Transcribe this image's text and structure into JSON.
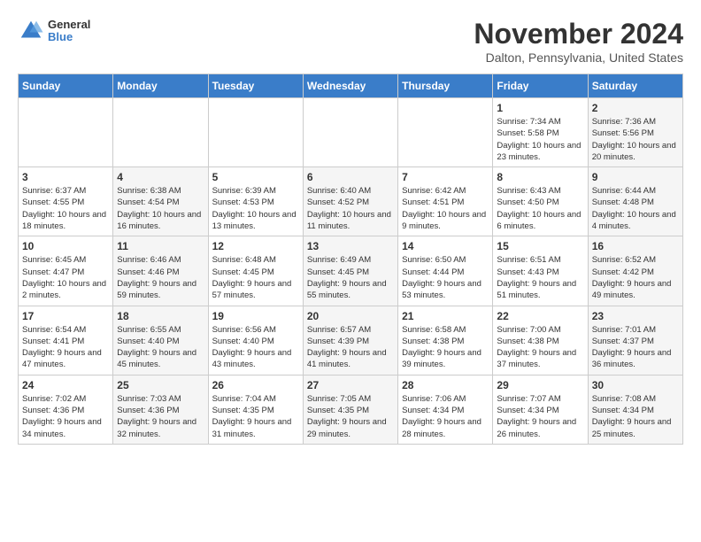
{
  "header": {
    "logo_general": "General",
    "logo_blue": "Blue",
    "month_title": "November 2024",
    "location": "Dalton, Pennsylvania, United States"
  },
  "weekdays": [
    "Sunday",
    "Monday",
    "Tuesday",
    "Wednesday",
    "Thursday",
    "Friday",
    "Saturday"
  ],
  "weeks": [
    [
      {
        "day": "",
        "sunrise": "",
        "sunset": "",
        "daylight": "",
        "shaded": false
      },
      {
        "day": "",
        "sunrise": "",
        "sunset": "",
        "daylight": "",
        "shaded": false
      },
      {
        "day": "",
        "sunrise": "",
        "sunset": "",
        "daylight": "",
        "shaded": false
      },
      {
        "day": "",
        "sunrise": "",
        "sunset": "",
        "daylight": "",
        "shaded": false
      },
      {
        "day": "",
        "sunrise": "",
        "sunset": "",
        "daylight": "",
        "shaded": false
      },
      {
        "day": "1",
        "sunrise": "Sunrise: 7:34 AM",
        "sunset": "Sunset: 5:58 PM",
        "daylight": "Daylight: 10 hours and 23 minutes.",
        "shaded": false
      },
      {
        "day": "2",
        "sunrise": "Sunrise: 7:36 AM",
        "sunset": "Sunset: 5:56 PM",
        "daylight": "Daylight: 10 hours and 20 minutes.",
        "shaded": true
      }
    ],
    [
      {
        "day": "3",
        "sunrise": "Sunrise: 6:37 AM",
        "sunset": "Sunset: 4:55 PM",
        "daylight": "Daylight: 10 hours and 18 minutes.",
        "shaded": false
      },
      {
        "day": "4",
        "sunrise": "Sunrise: 6:38 AM",
        "sunset": "Sunset: 4:54 PM",
        "daylight": "Daylight: 10 hours and 16 minutes.",
        "shaded": true
      },
      {
        "day": "5",
        "sunrise": "Sunrise: 6:39 AM",
        "sunset": "Sunset: 4:53 PM",
        "daylight": "Daylight: 10 hours and 13 minutes.",
        "shaded": false
      },
      {
        "day": "6",
        "sunrise": "Sunrise: 6:40 AM",
        "sunset": "Sunset: 4:52 PM",
        "daylight": "Daylight: 10 hours and 11 minutes.",
        "shaded": true
      },
      {
        "day": "7",
        "sunrise": "Sunrise: 6:42 AM",
        "sunset": "Sunset: 4:51 PM",
        "daylight": "Daylight: 10 hours and 9 minutes.",
        "shaded": false
      },
      {
        "day": "8",
        "sunrise": "Sunrise: 6:43 AM",
        "sunset": "Sunset: 4:50 PM",
        "daylight": "Daylight: 10 hours and 6 minutes.",
        "shaded": false
      },
      {
        "day": "9",
        "sunrise": "Sunrise: 6:44 AM",
        "sunset": "Sunset: 4:48 PM",
        "daylight": "Daylight: 10 hours and 4 minutes.",
        "shaded": true
      }
    ],
    [
      {
        "day": "10",
        "sunrise": "Sunrise: 6:45 AM",
        "sunset": "Sunset: 4:47 PM",
        "daylight": "Daylight: 10 hours and 2 minutes.",
        "shaded": false
      },
      {
        "day": "11",
        "sunrise": "Sunrise: 6:46 AM",
        "sunset": "Sunset: 4:46 PM",
        "daylight": "Daylight: 9 hours and 59 minutes.",
        "shaded": true
      },
      {
        "day": "12",
        "sunrise": "Sunrise: 6:48 AM",
        "sunset": "Sunset: 4:45 PM",
        "daylight": "Daylight: 9 hours and 57 minutes.",
        "shaded": false
      },
      {
        "day": "13",
        "sunrise": "Sunrise: 6:49 AM",
        "sunset": "Sunset: 4:45 PM",
        "daylight": "Daylight: 9 hours and 55 minutes.",
        "shaded": true
      },
      {
        "day": "14",
        "sunrise": "Sunrise: 6:50 AM",
        "sunset": "Sunset: 4:44 PM",
        "daylight": "Daylight: 9 hours and 53 minutes.",
        "shaded": false
      },
      {
        "day": "15",
        "sunrise": "Sunrise: 6:51 AM",
        "sunset": "Sunset: 4:43 PM",
        "daylight": "Daylight: 9 hours and 51 minutes.",
        "shaded": false
      },
      {
        "day": "16",
        "sunrise": "Sunrise: 6:52 AM",
        "sunset": "Sunset: 4:42 PM",
        "daylight": "Daylight: 9 hours and 49 minutes.",
        "shaded": true
      }
    ],
    [
      {
        "day": "17",
        "sunrise": "Sunrise: 6:54 AM",
        "sunset": "Sunset: 4:41 PM",
        "daylight": "Daylight: 9 hours and 47 minutes.",
        "shaded": false
      },
      {
        "day": "18",
        "sunrise": "Sunrise: 6:55 AM",
        "sunset": "Sunset: 4:40 PM",
        "daylight": "Daylight: 9 hours and 45 minutes.",
        "shaded": true
      },
      {
        "day": "19",
        "sunrise": "Sunrise: 6:56 AM",
        "sunset": "Sunset: 4:40 PM",
        "daylight": "Daylight: 9 hours and 43 minutes.",
        "shaded": false
      },
      {
        "day": "20",
        "sunrise": "Sunrise: 6:57 AM",
        "sunset": "Sunset: 4:39 PM",
        "daylight": "Daylight: 9 hours and 41 minutes.",
        "shaded": true
      },
      {
        "day": "21",
        "sunrise": "Sunrise: 6:58 AM",
        "sunset": "Sunset: 4:38 PM",
        "daylight": "Daylight: 9 hours and 39 minutes.",
        "shaded": false
      },
      {
        "day": "22",
        "sunrise": "Sunrise: 7:00 AM",
        "sunset": "Sunset: 4:38 PM",
        "daylight": "Daylight: 9 hours and 37 minutes.",
        "shaded": false
      },
      {
        "day": "23",
        "sunrise": "Sunrise: 7:01 AM",
        "sunset": "Sunset: 4:37 PM",
        "daylight": "Daylight: 9 hours and 36 minutes.",
        "shaded": true
      }
    ],
    [
      {
        "day": "24",
        "sunrise": "Sunrise: 7:02 AM",
        "sunset": "Sunset: 4:36 PM",
        "daylight": "Daylight: 9 hours and 34 minutes.",
        "shaded": false
      },
      {
        "day": "25",
        "sunrise": "Sunrise: 7:03 AM",
        "sunset": "Sunset: 4:36 PM",
        "daylight": "Daylight: 9 hours and 32 minutes.",
        "shaded": true
      },
      {
        "day": "26",
        "sunrise": "Sunrise: 7:04 AM",
        "sunset": "Sunset: 4:35 PM",
        "daylight": "Daylight: 9 hours and 31 minutes.",
        "shaded": false
      },
      {
        "day": "27",
        "sunrise": "Sunrise: 7:05 AM",
        "sunset": "Sunset: 4:35 PM",
        "daylight": "Daylight: 9 hours and 29 minutes.",
        "shaded": true
      },
      {
        "day": "28",
        "sunrise": "Sunrise: 7:06 AM",
        "sunset": "Sunset: 4:34 PM",
        "daylight": "Daylight: 9 hours and 28 minutes.",
        "shaded": false
      },
      {
        "day": "29",
        "sunrise": "Sunrise: 7:07 AM",
        "sunset": "Sunset: 4:34 PM",
        "daylight": "Daylight: 9 hours and 26 minutes.",
        "shaded": false
      },
      {
        "day": "30",
        "sunrise": "Sunrise: 7:08 AM",
        "sunset": "Sunset: 4:34 PM",
        "daylight": "Daylight: 9 hours and 25 minutes.",
        "shaded": true
      }
    ]
  ]
}
